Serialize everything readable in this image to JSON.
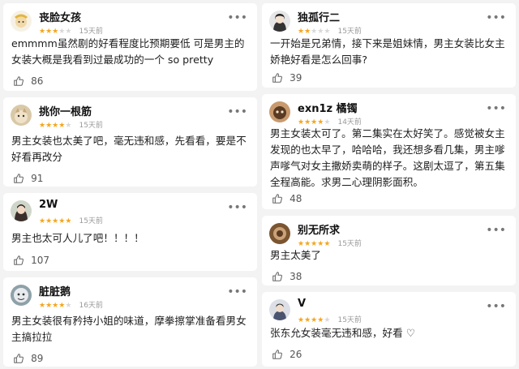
{
  "left": [
    {
      "name": "丧脸女孩",
      "rating": 3,
      "time": "15天前",
      "text": "emmmm虽然剧的好看程度比预期要低 可是男主的女装大概是我看到过最成功的一个 so pretty",
      "likes": "86"
    },
    {
      "name": "挑你一根筋",
      "rating": 4,
      "time": "15天前",
      "text": "男主女装也太美了吧，毫无违和感，先看看，要是不好看再改分",
      "likes": "91"
    },
    {
      "name": "2W",
      "rating": 5,
      "time": "15天前",
      "text": "男主也太可人儿了吧！！！！",
      "likes": "107"
    },
    {
      "name": "脏脏鹅",
      "rating": 4,
      "time": "16天前",
      "text": "男主女装很有矜持小姐的味道，摩拳擦掌准备看男女主搞拉拉",
      "likes": "89"
    }
  ],
  "right": [
    {
      "name": "独孤行二",
      "rating": 2,
      "time": "15天前",
      "text": "一开始是兄弟情，接下来是姐妹情，男主女装比女主娇艳好看是怎么回事?",
      "likes": "39"
    },
    {
      "name": "exn1z 橘镯",
      "rating": 4,
      "time": "14天前",
      "text": "男主女装太可了。第二集实在太好笑了。感觉被女主发现的也太早了，哈哈哈，我还想多看几集，男主嗲声嗲气对女主撒娇卖萌的样子。这剧太逗了，第五集全程高能。求男二心理阴影面积。",
      "likes": "48"
    },
    {
      "name": "别无所求",
      "rating": 5,
      "time": "15天前",
      "text": "男主太美了",
      "likes": "38"
    },
    {
      "name": "V",
      "rating": 4,
      "time": "15天前",
      "text": "张东允女装毫无违和感，好看 ♡",
      "likes": "26"
    }
  ],
  "icons": {
    "more": "more-dots-icon",
    "like": "thumbs-up-icon",
    "star": "star-icon"
  },
  "colors": {
    "star": "#f4a61f",
    "star_off": "#d8d8d8",
    "time": "#9a9a9a",
    "card": "#ffffff",
    "background": "#f3f3f3"
  }
}
